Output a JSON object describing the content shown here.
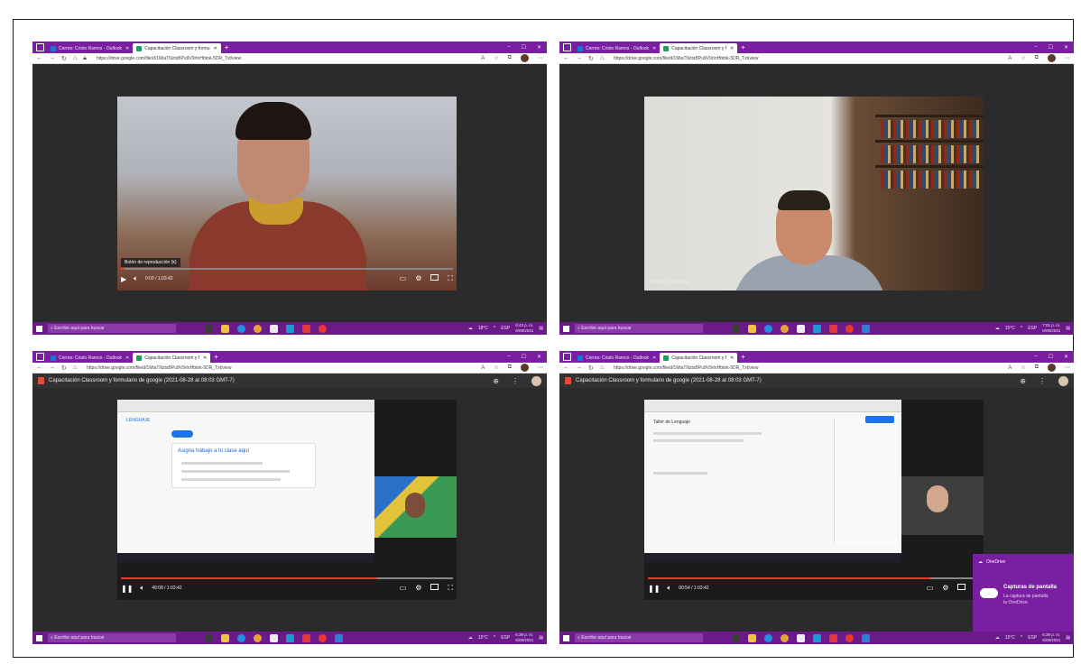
{
  "browser": {
    "tab_outlook": "Correo: Cristo Ramos - Outlook",
    "tab_drive_1": "Capacitación Classroom y formu",
    "tab_drive_short": "Capacitación Classroom y f",
    "url": "https://drive.google.com/file/d/1MiaTNztsBPu9V9rInHbtnk-5DR_Txt/view",
    "new_tab": "+",
    "minimize": "–",
    "maximize": "☐",
    "close": "✕"
  },
  "drive": {
    "title": "Capacitación Classroom y formulario de google (2021-08-28 at 08:03 GMT-7)",
    "share_icon": "add-person-icon",
    "more": "⋮"
  },
  "shots": [
    {
      "tooltip": "Botón de reproducción (k)",
      "time": "0:03 / 1:03:42",
      "progress": 0.01
    },
    {
      "name_label": "Hector cardenas"
    },
    {
      "time": "49:08 / 1:03:42",
      "progress": 0.77,
      "screen_title": "LENGUAJE",
      "card_title": "Asigna trabajo a tu clase aquí"
    },
    {
      "time": "00:54 / 1:03:42",
      "progress": 0.85,
      "form_title": "Taller de Lenguaje"
    }
  ],
  "taskbar": {
    "search_placeholder": "Escribe aquí para buscar",
    "weather_1": "18°C",
    "weather_2": "15°C",
    "lang": "ESP",
    "clock_1_time": "6:43 p. m.",
    "clock_1_date": "6/09/2021",
    "clock_2_time": "7:01 p. m.",
    "clock_2_date": "6/09/2021",
    "clock_3_time": "6:39 p. m.",
    "clock_3_date": "6/09/2021",
    "clock_4_time": "6:39 p. m.",
    "clock_4_date": "6/09/2021"
  },
  "toast": {
    "app": "OneDrive",
    "title": "Capturas de pantalla",
    "body_1": "La captura de pantalla",
    "body_2": "tu OneDrive."
  },
  "colors": {
    "accent_purple": "#7a1fa2",
    "progress_red": "#e63b2e"
  }
}
